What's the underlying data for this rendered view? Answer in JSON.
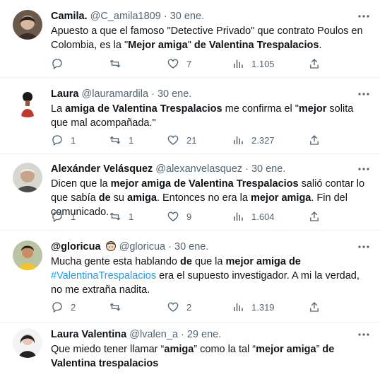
{
  "tweets": [
    {
      "name": "Camila.",
      "handle": "@C_amila1809",
      "dot": "·",
      "date": "30 ene.",
      "text": [
        {
          "t": "Apuesto a que el famoso \"Detective Privado\" que contrato Poulos en Colombia, es la \""
        },
        {
          "t": "Mejor amiga",
          "b": true
        },
        {
          "t": "\" "
        },
        {
          "t": "de Valentina Trespalacios",
          "b": true
        },
        {
          "t": "."
        }
      ],
      "replies": "",
      "retweets": "",
      "likes": "7",
      "views": "1.105"
    },
    {
      "name": "Laura",
      "handle": "@lauramardila",
      "dot": "·",
      "date": "30 ene.",
      "text": [
        {
          "t": "La "
        },
        {
          "t": "amiga de Valentina Trespalacios",
          "b": true
        },
        {
          "t": " me confirma el \""
        },
        {
          "t": "mejor",
          "b": true
        },
        {
          "t": " solita que mal acompañada.\""
        }
      ],
      "replies": "1",
      "retweets": "1",
      "likes": "21",
      "views": "2.327"
    },
    {
      "name": "Alexánder Velásquez",
      "handle": "@alexanvelasquez",
      "dot": "·",
      "date": "30 ene.",
      "text": [
        {
          "t": "Dicen que la "
        },
        {
          "t": "mejor amiga de Valentina Trespalacios",
          "b": true
        },
        {
          "t": " salió contar lo que sabía "
        },
        {
          "t": "de",
          "b": true
        },
        {
          "t": " su "
        },
        {
          "t": "amiga",
          "b": true
        },
        {
          "t": ". Entonces no era la "
        },
        {
          "t": "mejor amiga",
          "b": true
        },
        {
          "t": ". Fin del comunicado."
        }
      ],
      "replies": "1",
      "retweets": "1",
      "likes": "9",
      "views": "1.604"
    },
    {
      "name": "@gloricua",
      "handle": "@gloricua",
      "dot": "·",
      "date": "30 ene.",
      "text": [
        {
          "t": "Mucha gente esta hablando "
        },
        {
          "t": "de",
          "b": true
        },
        {
          "t": " que la "
        },
        {
          "t": "mejor amiga de",
          "b": true
        },
        {
          "t": " "
        },
        {
          "t": "#ValentinaTrespalacios",
          "tag": true
        },
        {
          "t": " era el supuesto investigador. A mi la verdad, no me extraña nadita."
        }
      ],
      "replies": "2",
      "retweets": "",
      "likes": "2",
      "views": "1.319"
    },
    {
      "name": "Laura Valentina",
      "handle": "@lvalen_a",
      "dot": "·",
      "date": "29 ene.",
      "text": [
        {
          "t": "Que miedo tener llamar “"
        },
        {
          "t": "amiga",
          "b": true
        },
        {
          "t": "” como la tal “"
        },
        {
          "t": "mejor amiga",
          "b": true
        },
        {
          "t": "” "
        },
        {
          "t": "de Valentina trespalacios",
          "b": true
        }
      ]
    }
  ],
  "colors": {
    "text": "#0f1419",
    "muted": "#536471",
    "hashtag": "#1d9bf0",
    "divider": "#eff3f4"
  }
}
